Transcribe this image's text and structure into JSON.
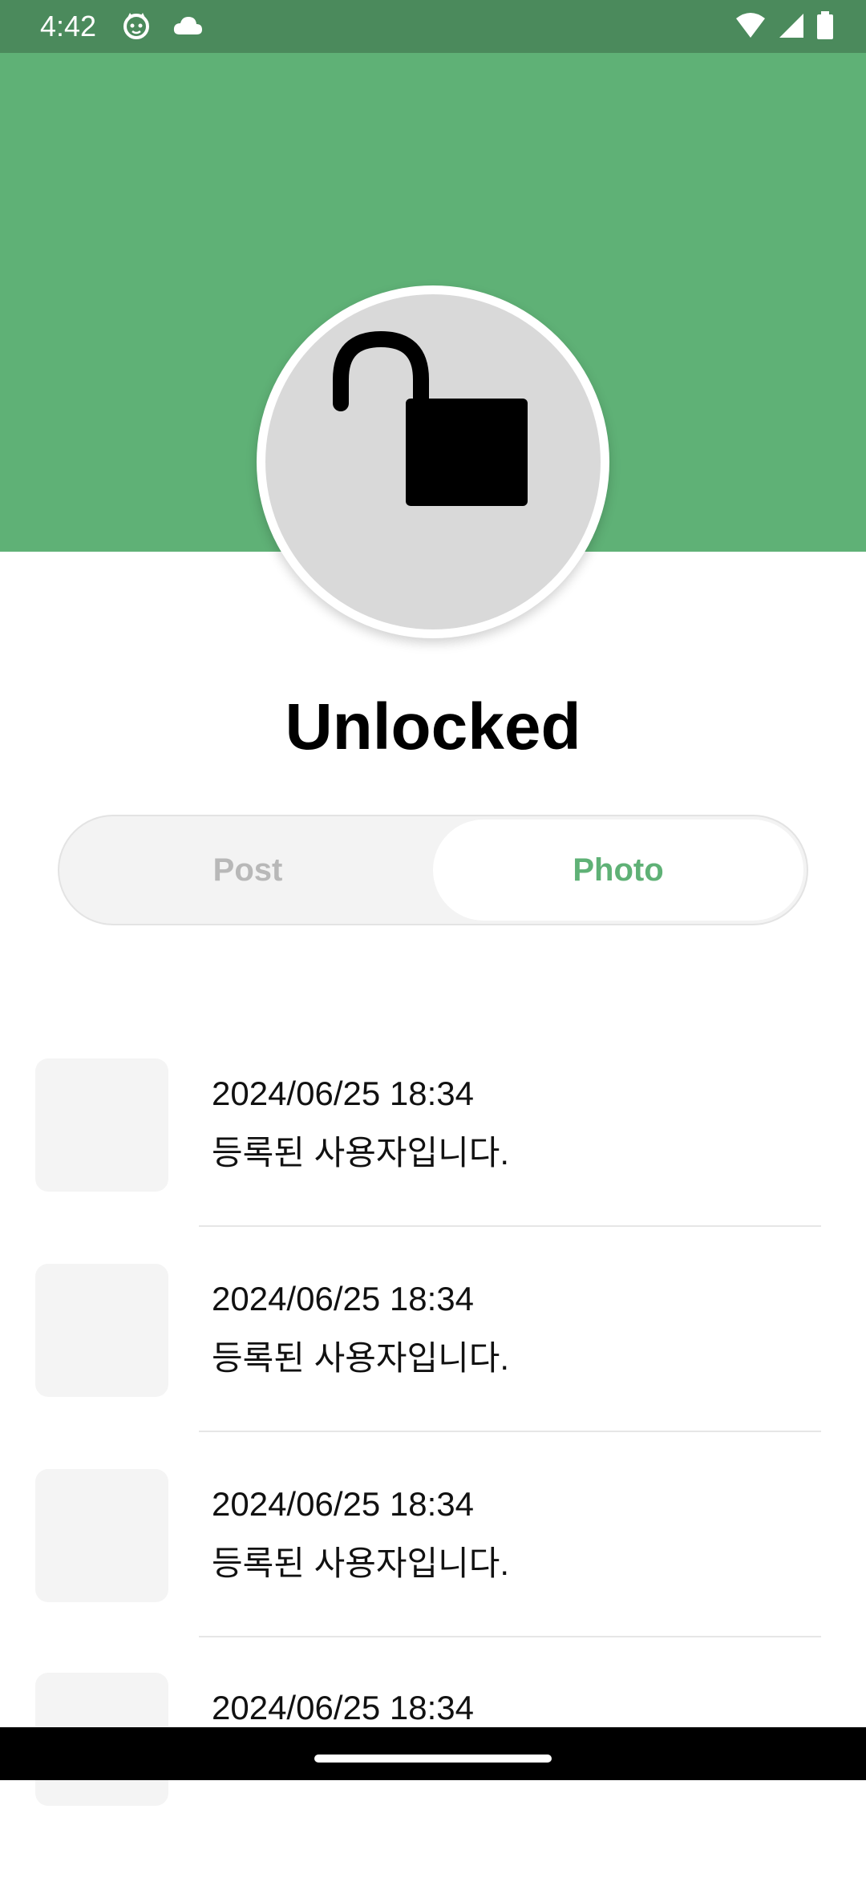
{
  "status_bar": {
    "time": "4:42",
    "left_icons": [
      "cat-icon",
      "cloud-icon"
    ],
    "right_icons": [
      "wifi-icon",
      "signal-icon",
      "battery-icon"
    ]
  },
  "colors": {
    "header_green": "#5fb176",
    "status_green": "#4b8a5c",
    "accent": "#5fb176"
  },
  "profile": {
    "icon": "lock-open-icon",
    "title": "Unlocked"
  },
  "tabs": [
    {
      "label": "Post",
      "selected": false
    },
    {
      "label": "Photo",
      "selected": true
    }
  ],
  "items": [
    {
      "date": "2024/06/25 18:34",
      "text": "등록된 사용자입니다."
    },
    {
      "date": "2024/06/25 18:34",
      "text": "등록된 사용자입니다."
    },
    {
      "date": "2024/06/25 18:34",
      "text": "등록된 사용자입니다."
    },
    {
      "date": "2024/06/25 18:34",
      "text": ""
    }
  ]
}
